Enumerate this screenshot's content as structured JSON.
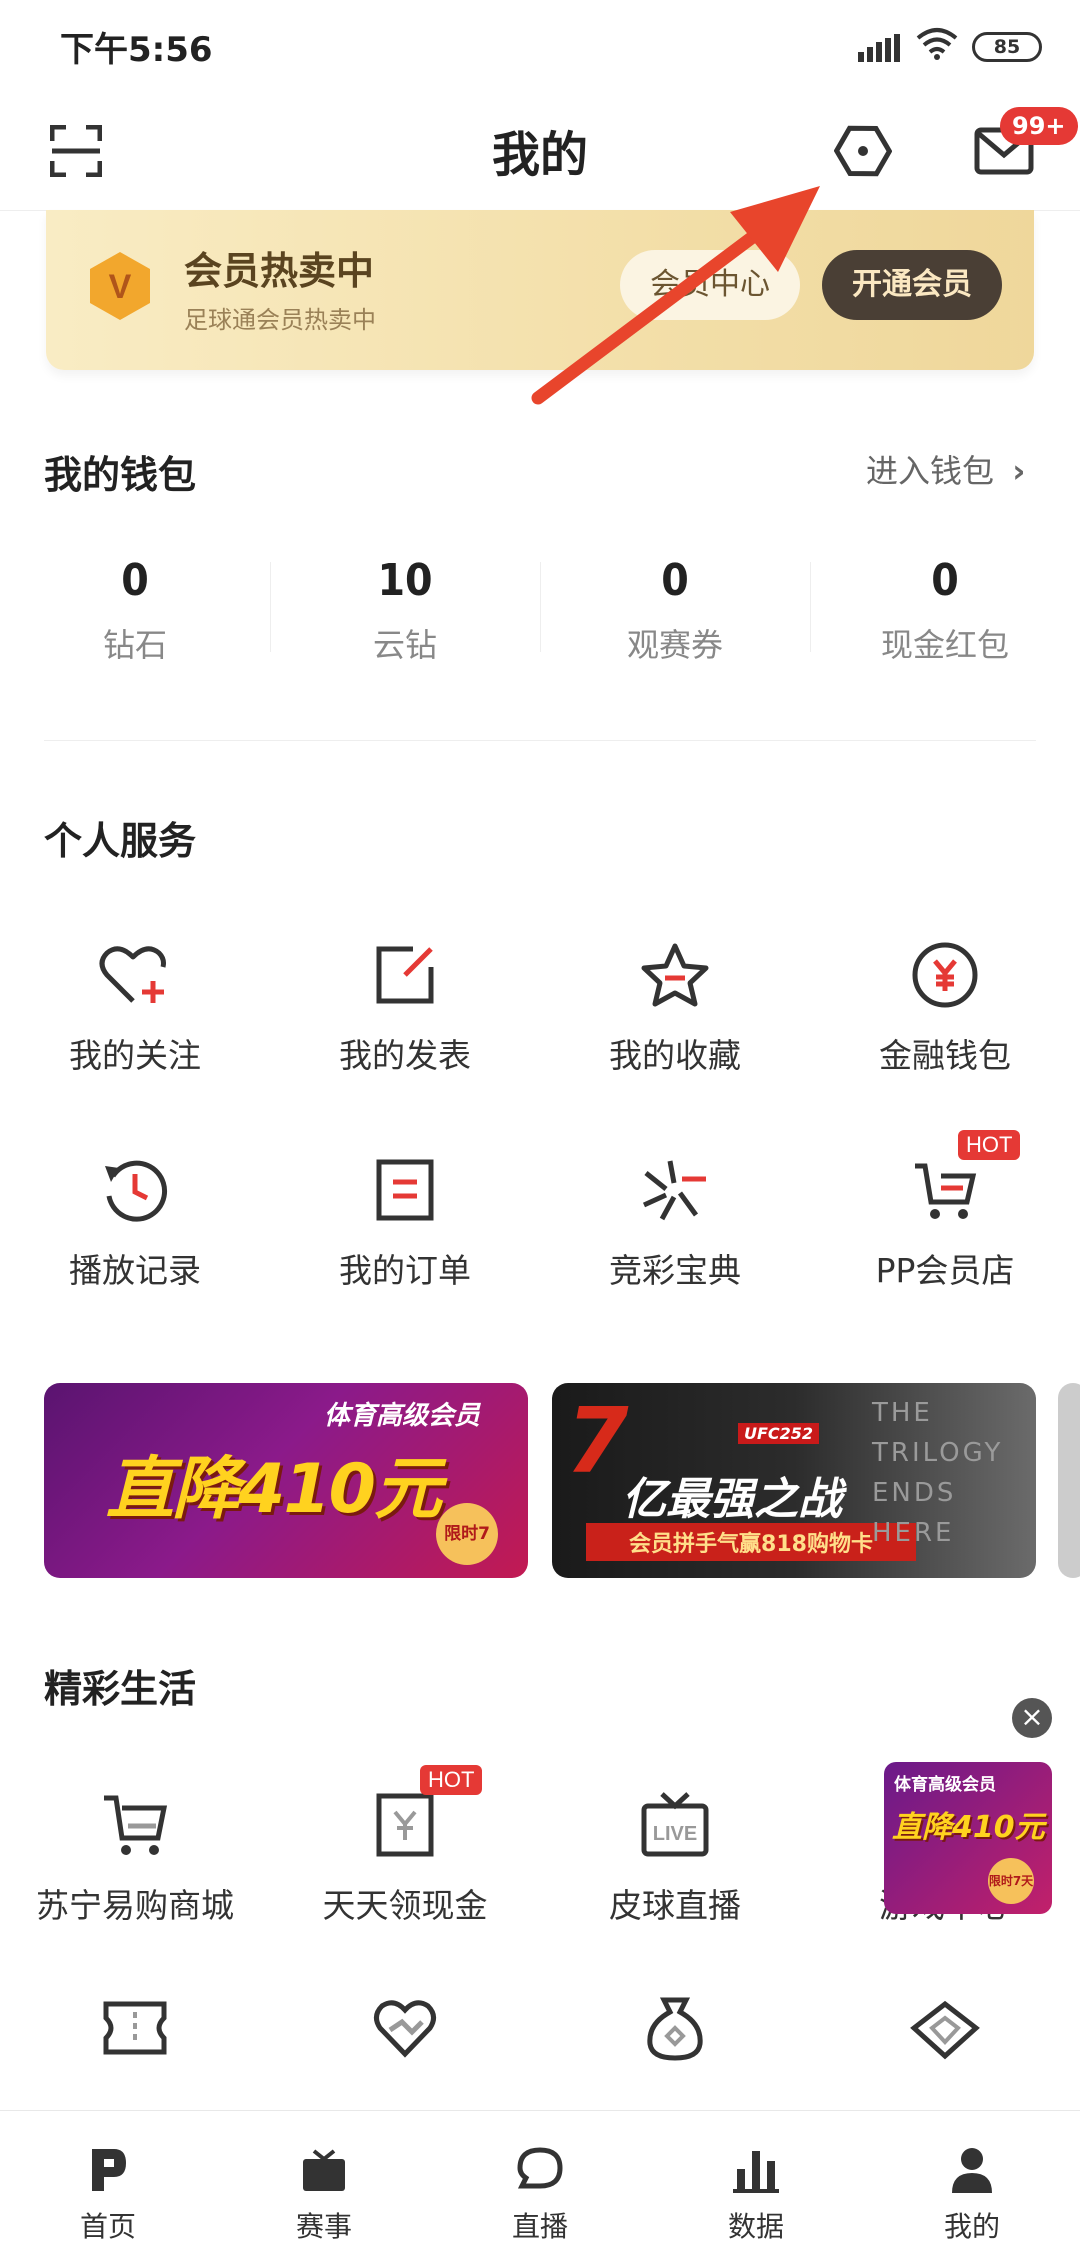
{
  "status_bar": {
    "time": "下午5:56",
    "battery": "85"
  },
  "header": {
    "title": "我的",
    "message_badge": "99+"
  },
  "vip": {
    "title": "会员热卖中",
    "subtitle": "足球通会员热卖中",
    "center_button": "会员中心",
    "open_button": "开通会员",
    "logo_letter": "V"
  },
  "wallet": {
    "title": "我的钱包",
    "link": "进入钱包",
    "items": [
      {
        "value": "0",
        "label": "钻石"
      },
      {
        "value": "10",
        "label": "云钻"
      },
      {
        "value": "0",
        "label": "观赛券"
      },
      {
        "value": "0",
        "label": "现金红包"
      }
    ]
  },
  "personal": {
    "title": "个人服务",
    "items": [
      {
        "label": "我的关注",
        "icon": "heart-plus-icon"
      },
      {
        "label": "我的发表",
        "icon": "edit-icon"
      },
      {
        "label": "我的收藏",
        "icon": "star-icon"
      },
      {
        "label": "金融钱包",
        "icon": "yen-coin-icon"
      },
      {
        "label": "播放记录",
        "icon": "history-icon"
      },
      {
        "label": "我的订单",
        "icon": "order-icon"
      },
      {
        "label": "竞彩宝典",
        "icon": "sparkle-icon"
      },
      {
        "label": "PP会员店",
        "icon": "cart-icon",
        "badge": "HOT"
      }
    ]
  },
  "banners": {
    "b1_top": "体育高级会员",
    "b1_main": "直降410元",
    "b1_tag": "限时7天",
    "b2_tag": "UFC252",
    "b2_main": "亿最强之战",
    "b2_sub": "会员拼手气赢818购物卡",
    "b2_side": "THE TRILOGY ENDS HERE"
  },
  "life": {
    "title": "精彩生活",
    "items": [
      {
        "label": "苏宁易购商城",
        "icon": "shopping-cart-icon"
      },
      {
        "label": "天天领现金",
        "icon": "cash-icon",
        "badge": "HOT"
      },
      {
        "label": "皮球直播",
        "icon": "live-tv-icon"
      },
      {
        "label": "游戏中心",
        "icon": "game-icon"
      }
    ],
    "row2_icons": [
      "ticket-icon",
      "heart-hand-icon",
      "money-bag-icon",
      "diamond-icon"
    ],
    "float_ad": {
      "top": "体育高级会员",
      "main": "直降410元",
      "tag": "限时7天"
    }
  },
  "bottom_nav": [
    {
      "label": "首页",
      "icon": "pp-logo-icon"
    },
    {
      "label": "赛事",
      "icon": "tv-icon"
    },
    {
      "label": "直播",
      "icon": "chat-bubble-icon"
    },
    {
      "label": "数据",
      "icon": "bar-chart-icon"
    },
    {
      "label": "我的",
      "icon": "user-icon"
    }
  ],
  "colors": {
    "accent": "#e53935",
    "gold": "#f3dfa9",
    "dark_button": "#4a3f35",
    "arrow": "#e8452c"
  }
}
